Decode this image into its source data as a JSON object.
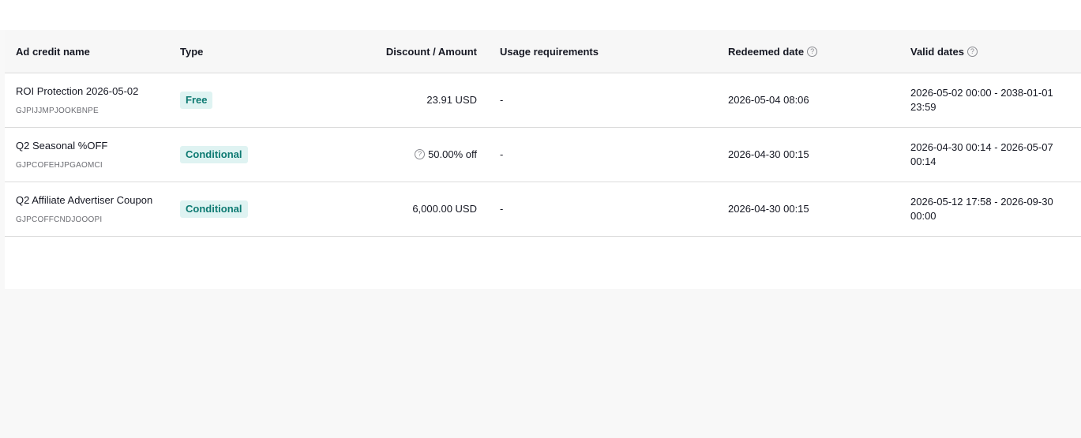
{
  "table": {
    "columns": [
      {
        "key": "name",
        "label": "Ad credit name"
      },
      {
        "key": "type",
        "label": "Type"
      },
      {
        "key": "amount",
        "label": "Discount / Amount"
      },
      {
        "key": "usage",
        "label": "Usage requirements"
      },
      {
        "key": "redeemed",
        "label": "Redeemed date"
      },
      {
        "key": "valid",
        "label": "Valid dates"
      }
    ],
    "help_icon": "question-circle-icon",
    "rows": [
      {
        "name": "ROI Protection 2026-05-02",
        "code": "GJPIJJMPJOOKBNPE",
        "type": "Free",
        "amount": "23.91 USD",
        "amount_has_help": false,
        "usage": "-",
        "redeemed": "2026-05-04 08:06",
        "valid": "2026-05-02 00:00 - 2038-01-01 23:59"
      },
      {
        "name": "Q2 Seasonal %OFF",
        "code": "GJPCOFEHJPGAOMCI",
        "type": "Conditional",
        "amount": "50.00% off",
        "amount_has_help": true,
        "usage": "-",
        "redeemed": "2026-04-30 00:15",
        "valid": "2026-04-30 00:14 - 2026-05-07 00:14"
      },
      {
        "name": "Q2 Affiliate Advertiser Coupon",
        "code": "GJPCOFFCNDJOOOPI",
        "type": "Conditional",
        "amount": "6,000.00 USD",
        "amount_has_help": false,
        "usage": "-",
        "redeemed": "2026-04-30 00:15",
        "valid": "2026-05-12 17:58 - 2026-09-30 00:00"
      }
    ]
  },
  "colors": {
    "badge_bg": "#dff3f2",
    "badge_text": "#0d7a72",
    "header_bg": "#f7f7f7",
    "page_bg": "#f8f8f8"
  }
}
